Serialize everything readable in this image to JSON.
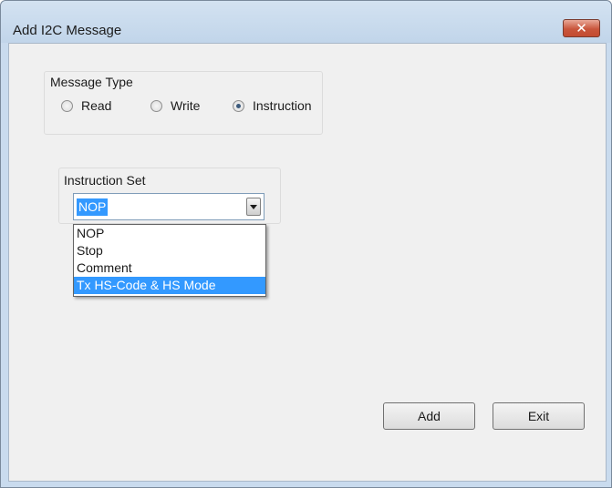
{
  "window": {
    "title": "Add I2C Message",
    "close_glyph": "✕"
  },
  "message_type": {
    "label": "Message Type",
    "options": [
      {
        "label": "Read",
        "checked": false
      },
      {
        "label": "Write",
        "checked": false
      },
      {
        "label": "Instruction",
        "checked": true
      }
    ]
  },
  "instruction_set": {
    "label": "Instruction Set",
    "selected_value": "NOP",
    "dropdown_items": [
      {
        "label": "NOP",
        "highlighted": false
      },
      {
        "label": "Stop",
        "highlighted": false
      },
      {
        "label": "Comment",
        "highlighted": false
      },
      {
        "label": "Tx HS-Code & HS Mode",
        "highlighted": true
      }
    ]
  },
  "buttons": {
    "add_label": "Add",
    "exit_label": "Exit"
  },
  "colors": {
    "selection": "#3399ff",
    "titlebar": "#c9dbee",
    "close_button": "#c9563c",
    "client_background": "#f0f0f0"
  }
}
